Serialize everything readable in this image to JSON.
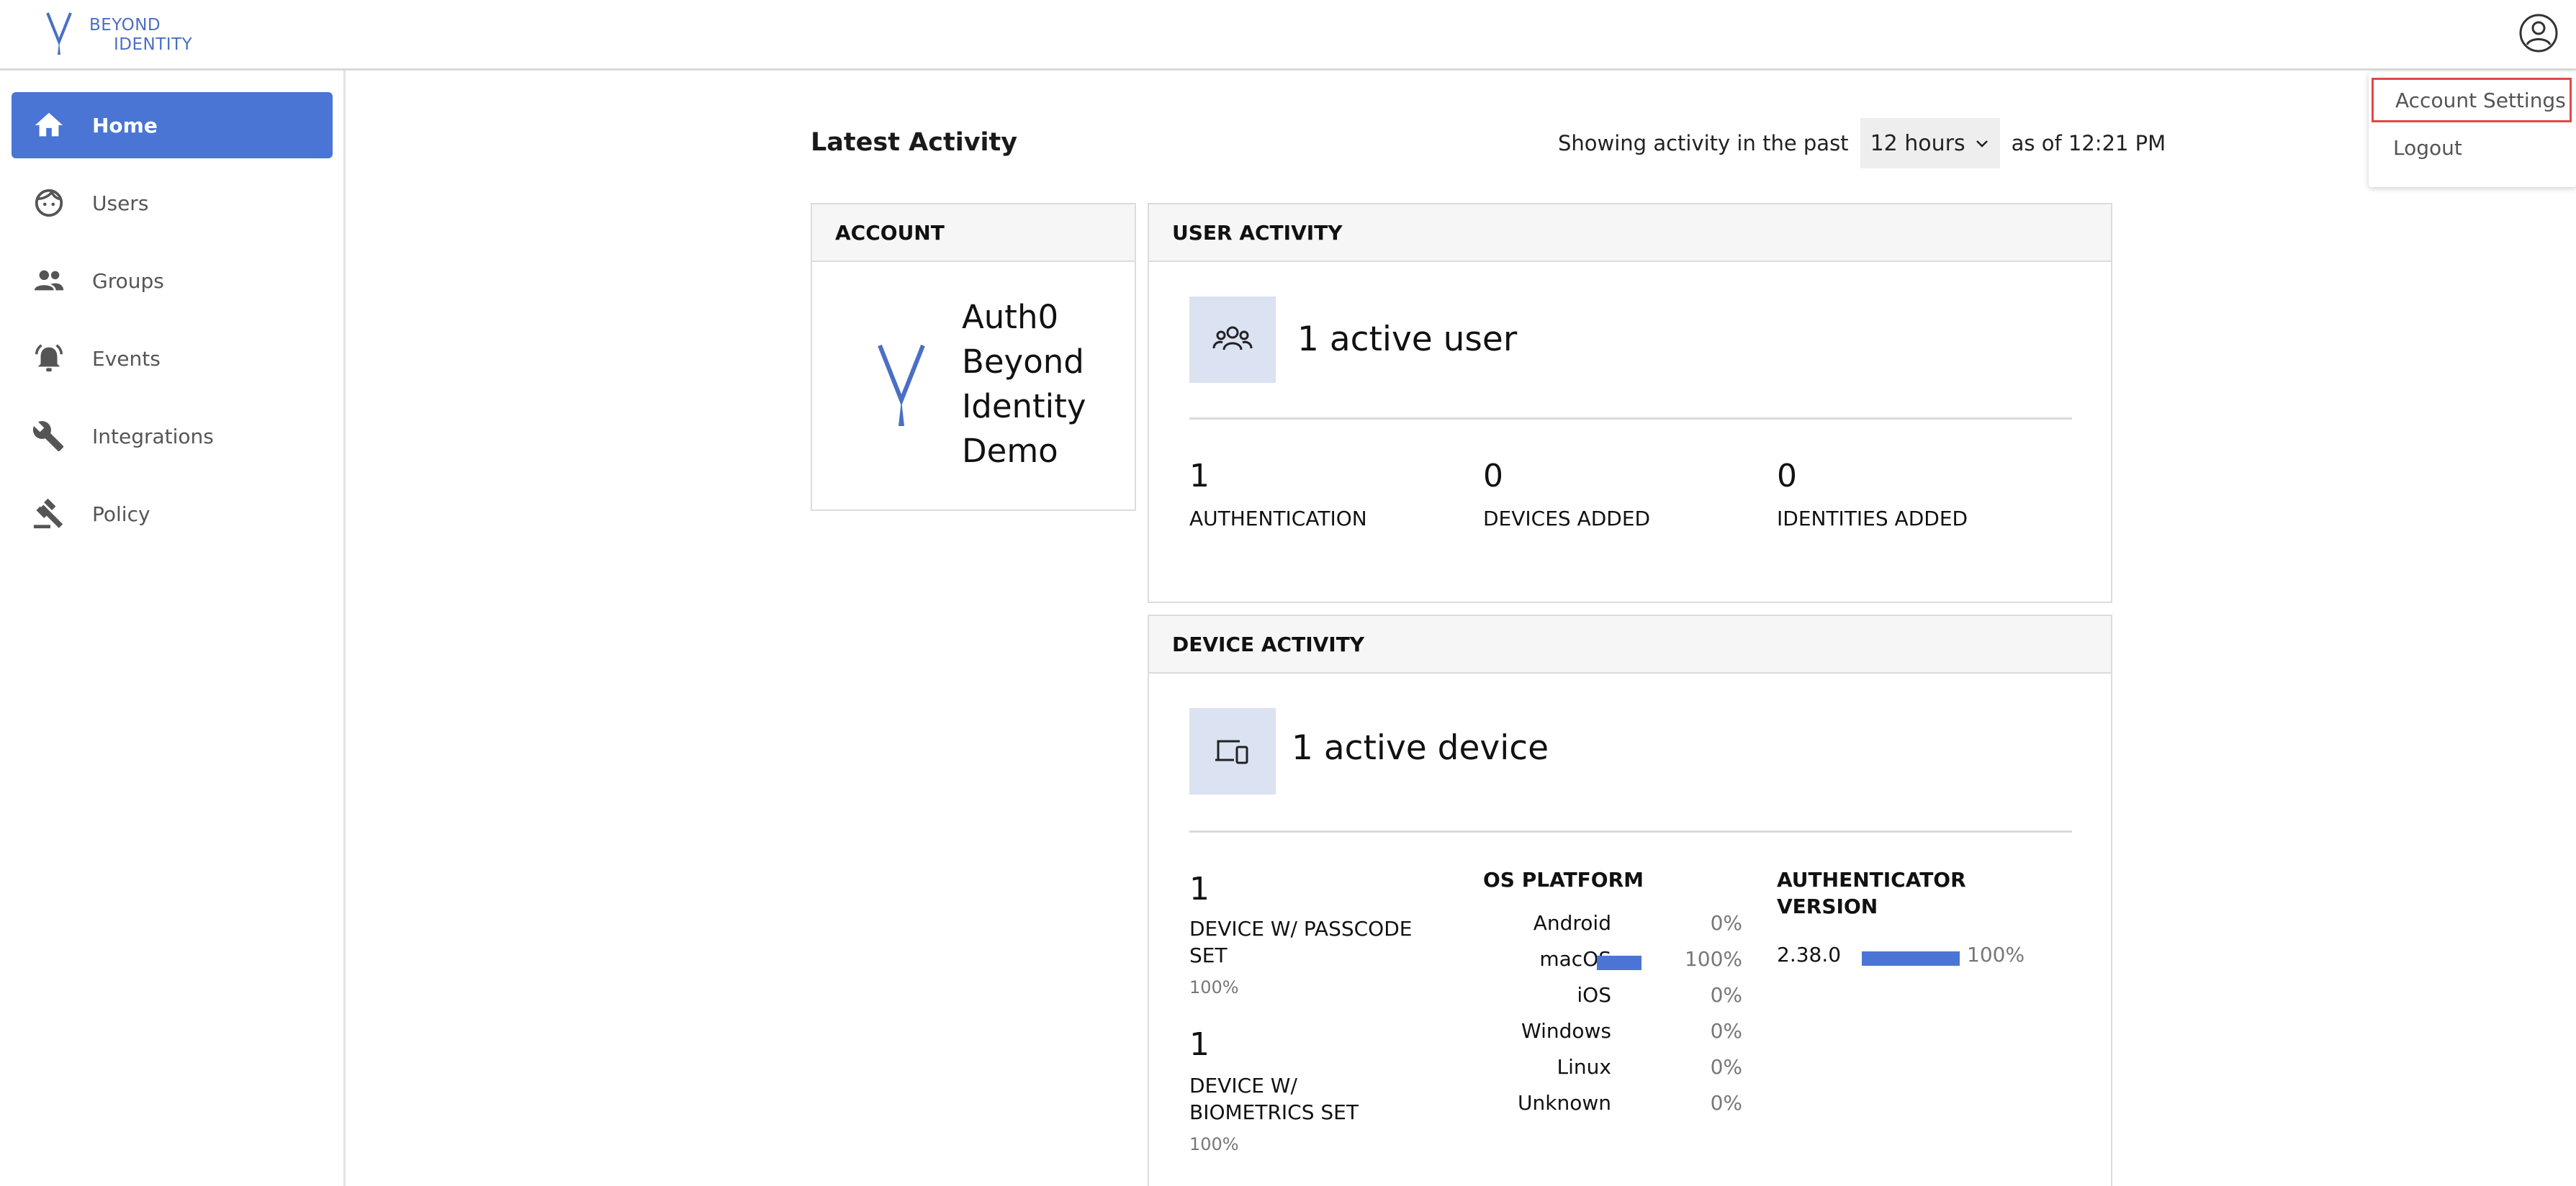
{
  "brand": {
    "line1": "BEYOND",
    "line2": "IDENTITY",
    "color": "#4a6fc4"
  },
  "sidebar": {
    "items": [
      {
        "label": "Home",
        "icon": "home-icon",
        "active": true
      },
      {
        "label": "Users",
        "icon": "face-icon"
      },
      {
        "label": "Groups",
        "icon": "people-icon"
      },
      {
        "label": "Events",
        "icon": "alarm-icon"
      },
      {
        "label": "Integrations",
        "icon": "wrench-icon"
      },
      {
        "label": "Policy",
        "icon": "gavel-icon"
      }
    ]
  },
  "main": {
    "title": "Latest Activity",
    "showing_prefix": "Showing activity in the past",
    "period": "12 hours",
    "as_of": "as of 12:21 PM"
  },
  "account": {
    "header": "ACCOUNT",
    "name": "Auth0 Beyond Identity Demo"
  },
  "user_activity": {
    "header": "USER ACTIVITY",
    "active_users": "1 active user",
    "stats": [
      {
        "value": "1",
        "label": "AUTHENTICATION"
      },
      {
        "value": "0",
        "label": "DEVICES ADDED"
      },
      {
        "value": "0",
        "label": "IDENTITIES ADDED"
      }
    ]
  },
  "device_activity": {
    "header": "DEVICE ACTIVITY",
    "active_devices": "1 active device",
    "passcode": {
      "value": "1",
      "label": "DEVICE W/ PASSCODE SET",
      "pct": "100%"
    },
    "biometrics": {
      "value": "1",
      "label": "DEVICE W/ BIOMETRICS SET",
      "pct": "100%"
    },
    "os_platform": {
      "title": "OS PLATFORM",
      "rows": [
        {
          "name": "Android",
          "pct": "0%",
          "fraction": 0
        },
        {
          "name": "macOS",
          "pct": "100%",
          "fraction": 1
        },
        {
          "name": "iOS",
          "pct": "0%",
          "fraction": 0
        },
        {
          "name": "Windows",
          "pct": "0%",
          "fraction": 0
        },
        {
          "name": "Linux",
          "pct": "0%",
          "fraction": 0
        },
        {
          "name": "Unknown",
          "pct": "0%",
          "fraction": 0
        }
      ]
    },
    "authenticator": {
      "title": "AUTHENTICATOR VERSION",
      "rows": [
        {
          "version": "2.38.0",
          "pct": "100%",
          "fraction": 1
        }
      ]
    }
  },
  "user_menu": {
    "items": [
      {
        "label": "Account Settings"
      },
      {
        "label": "Logout"
      }
    ]
  },
  "colors": {
    "accent": "#4a75d4",
    "icon_box": "#dbe2f1",
    "focus_outline": "#e04848"
  }
}
